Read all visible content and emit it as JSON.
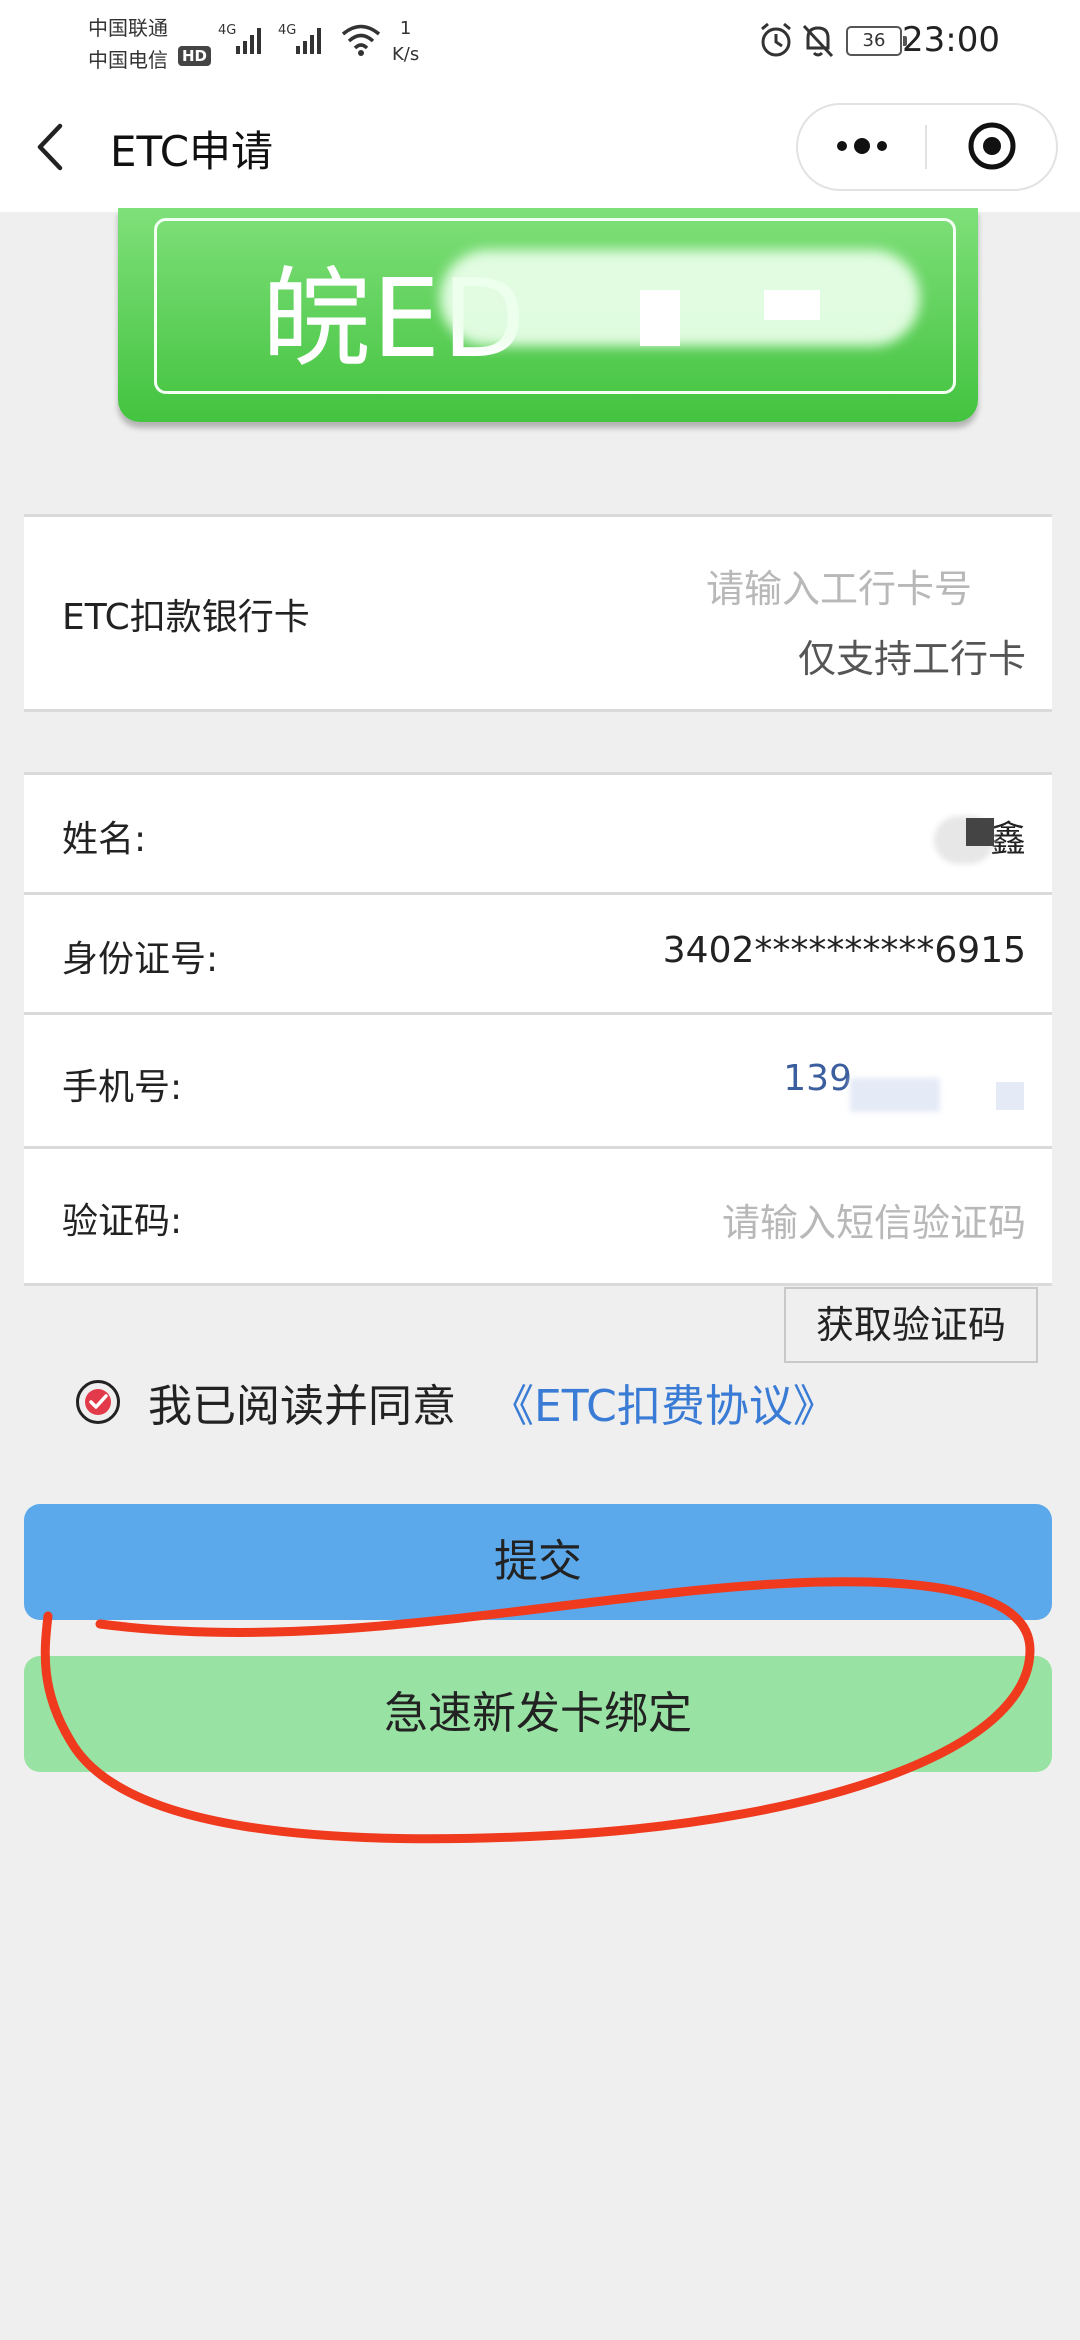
{
  "status_bar": {
    "carrier1": "中国联通",
    "carrier2": "中国电信",
    "hd": "HD",
    "net_type1": "4G",
    "net_type2": "4G",
    "speed_value": "1",
    "speed_unit": "K/s",
    "battery": "36",
    "time": "23:00"
  },
  "nav": {
    "title": "ETC申请",
    "back_icon": "chevron-left-icon",
    "more_icon": "more-dots-icon",
    "close_icon": "target-circle-icon"
  },
  "plate": {
    "text": "皖ED"
  },
  "bank": {
    "label": "ETC扣款银行卡",
    "placeholder": "请输入工行卡号",
    "hint": "仅支持工行卡"
  },
  "form": {
    "name_label": "姓名:",
    "name_value": "鑫",
    "id_label": "身份证号:",
    "id_value": "3402**********6915",
    "phone_label": "手机号:",
    "phone_value": "139",
    "code_label": "验证码:",
    "code_placeholder": "请输入短信验证码",
    "get_code_button": "获取验证码"
  },
  "agreement": {
    "text": "我已阅读并同意",
    "link": "《ETC扣费协议》",
    "checked": true
  },
  "buttons": {
    "submit": "提交",
    "quick_bind": "急速新发卡绑定"
  },
  "colors": {
    "plate_green": "#43c33f",
    "submit_blue": "#5ba8ea",
    "quick_green": "#98e3a3",
    "link_blue": "#3a7bd5",
    "annotation_red": "#f03a1e"
  }
}
